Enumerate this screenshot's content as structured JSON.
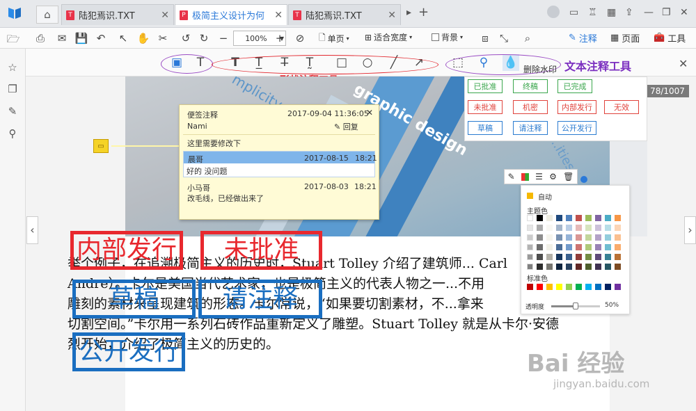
{
  "tabs": [
    {
      "label": "陆犯焉识.TXT",
      "type": "TXT",
      "active": false
    },
    {
      "label": "极简主义设计为何",
      "type": "PDF",
      "active": true
    },
    {
      "label": "陆犯焉识.TXT",
      "type": "TXT",
      "active": false
    }
  ],
  "toolbar": {
    "zoom_value": "100%",
    "single_page": "单页",
    "fit_width": "适合宽度",
    "background": "背景",
    "annotate": "注释",
    "page_view": "页面",
    "tools": "工具"
  },
  "annotation_bar": {
    "shape_tools_label": "形状注释工具",
    "text_tools_label": "文本注释工具",
    "remove_watermark": "删除水印"
  },
  "page_indicator": "78/1007",
  "photo_texts": [
    "mplicity",
    "graphic design",
    "...ities"
  ],
  "body_text": [
    "举个例子，在追溯极简主义的历史时，Stuart Tolley 介绍了建筑师... Carl",
    "Andre）。卡尔是美国当代艺术家，也是极简主义的代表人物之一...不用",
    "雕刻的素材来呈现建筑的形态。卡尔常说，“如果要切割素材，不...拿来",
    "切割空间。”卡尔用一系列石砖作品重新定义了雕塑。Stuart Tolley 就是从卡尔·安德",
    "烈开始，介绍了极简主义的历史的。"
  ],
  "stamps_on_page": [
    "内部发行",
    "未批准",
    "草稿",
    "请注释",
    "公开发行"
  ],
  "sticky_note": {
    "title": "便签注释",
    "datetime": "2017-09-04 11:36:05",
    "author": "Nami",
    "reply_label": "回复",
    "message": "这里需要修改下",
    "replies": [
      {
        "user": "晨哥",
        "date": "2017-08-15",
        "time": "18:21",
        "text": "好的 没问题",
        "selected": true
      },
      {
        "user": "小马哥",
        "date": "2017-08-03",
        "time": "18:21",
        "text": "改毛线，已经做出来了",
        "selected": false
      }
    ]
  },
  "stamp_panel": {
    "rows": [
      [
        {
          "label": "已批准",
          "color": "green"
        },
        {
          "label": "终稿",
          "color": "green"
        },
        {
          "label": "已完成",
          "color": "green"
        }
      ],
      [
        {
          "label": "未批准",
          "color": "red"
        },
        {
          "label": "机密",
          "color": "red"
        },
        {
          "label": "内部发行",
          "color": "red"
        },
        {
          "label": "无效",
          "color": "red"
        }
      ],
      [
        {
          "label": "草稿",
          "color": "blue"
        },
        {
          "label": "请注释",
          "color": "blue"
        },
        {
          "label": "公开发行",
          "color": "blue"
        }
      ]
    ]
  },
  "color_panel": {
    "auto_label": "自动",
    "theme_label": "主题色",
    "standard_label": "标准色",
    "opacity_label": "透明度",
    "opacity_value": "50%",
    "opacity_fraction": 0.5,
    "theme_top": [
      "#ffffff",
      "#000000",
      "#eeece1",
      "#1f497d",
      "#4f81bd",
      "#c0504d",
      "#9bbb59",
      "#8064a2",
      "#4bacc6",
      "#f79646"
    ],
    "standard": [
      "#c00000",
      "#ff0000",
      "#ffc000",
      "#ffff00",
      "#92d050",
      "#00b050",
      "#00b0f0",
      "#0070c0",
      "#002060",
      "#7030a0"
    ],
    "auto_color": "#f5b800"
  },
  "watermark": {
    "brand": "Bai 经验",
    "url": "jingyan.baidu.com"
  },
  "colors": {
    "accent_blue": "#2b79d8",
    "stamp_red": "#e8282e",
    "stamp_blue": "#1a6ec0",
    "label_red": "#e2262d",
    "label_purple": "#7b2fc0"
  }
}
